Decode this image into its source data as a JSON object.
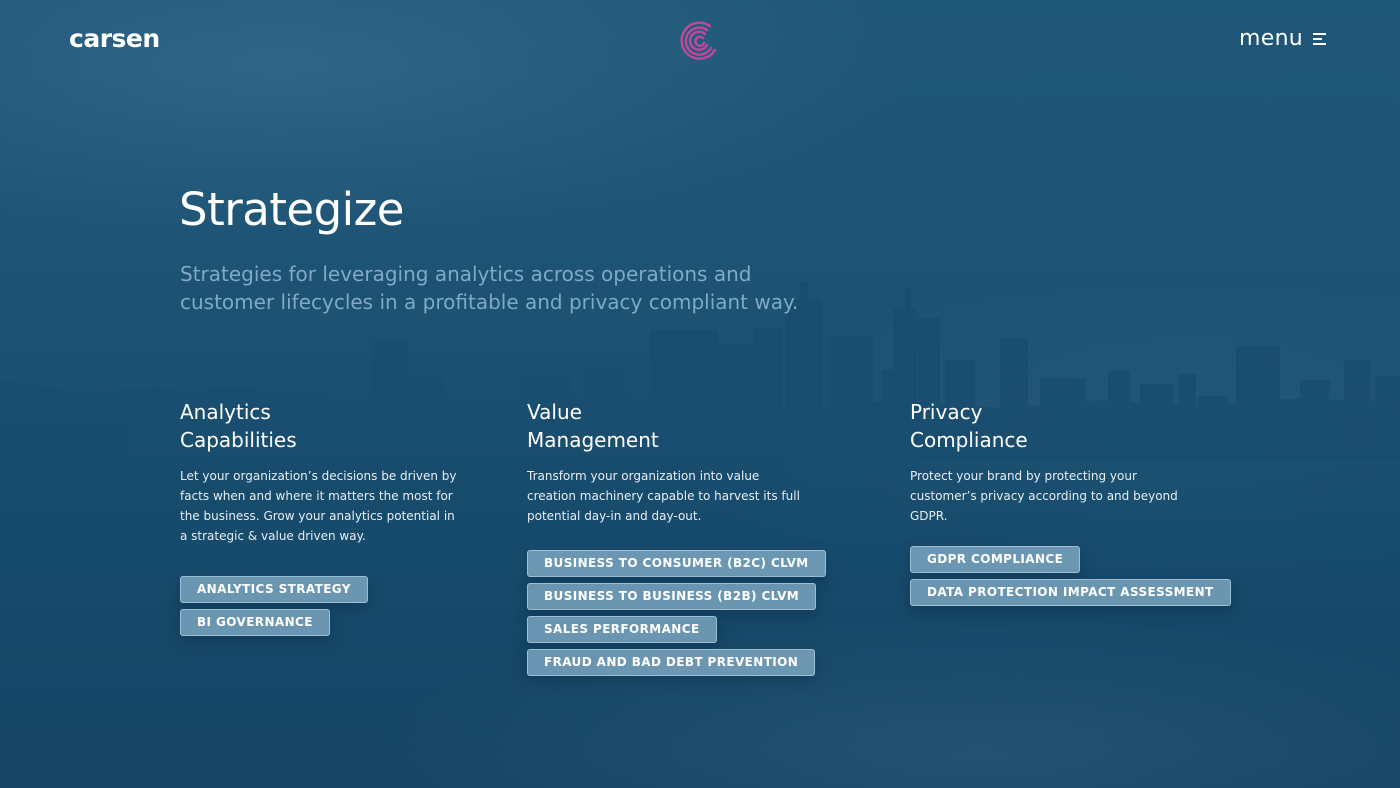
{
  "header": {
    "brand": "carsen",
    "menu_label": "menu",
    "logo_icon": "spiral-c-logo-icon",
    "menu_icon": "hamburger-icon",
    "accent_color": "#c2479a"
  },
  "hero": {
    "title": "Strategize",
    "subtitle": "Strategies for leveraging analytics across operations and customer lifecycles in a profitable and privacy compliant way."
  },
  "columns": [
    {
      "title": "Analytics\nCapabilities",
      "description": "Let your organization’s decisions be driven by\nfacts when and where it matters the most for\nthe business. Grow your analytics potential in\na strategic & value driven way.",
      "tags": [
        "ANALYTICS STRATEGY",
        "BI GOVERNANCE"
      ]
    },
    {
      "title": "Value\nManagement",
      "description": "Transform your organization into value\ncreation machinery capable to harvest its full\npotential day-in and day-out.",
      "tags": [
        "BUSINESS TO CONSUMER (B2C) CLVM",
        "BUSINESS TO BUSINESS (B2B) CLVM",
        "SALES PERFORMANCE",
        "FRAUD AND BAD DEBT PREVENTION"
      ]
    },
    {
      "title": "Privacy\nCompliance",
      "description": "Protect your brand by protecting your\ncustomer’s privacy according to and beyond\nGDPR.",
      "tags": [
        "GDPR COMPLIANCE",
        "DATA PROTECTION IMPACT ASSESSMENT"
      ]
    }
  ]
}
